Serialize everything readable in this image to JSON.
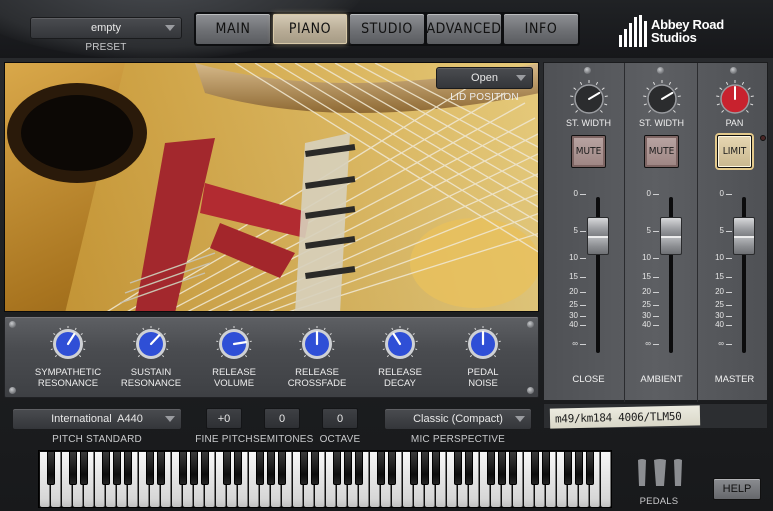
{
  "header": {
    "preset": {
      "value": "empty",
      "label": "PRESET"
    },
    "tabs": [
      {
        "label": "MAIN",
        "active": false
      },
      {
        "label": "PIANO",
        "active": true
      },
      {
        "label": "STUDIO",
        "active": false
      },
      {
        "label": "ADVANCED",
        "active": false
      },
      {
        "label": "INFO",
        "active": false
      }
    ],
    "logo": {
      "line1": "Abbey Road",
      "line2": "Studios"
    }
  },
  "piano_view": {
    "lid_position": {
      "value": "Open",
      "label": "LID POSITION"
    }
  },
  "knobs": [
    {
      "line1": "SYMPATHETIC",
      "line2": "RESONANCE",
      "level": 0.62
    },
    {
      "line1": "SUSTAIN",
      "line2": "RESONANCE",
      "level": 0.66
    },
    {
      "line1": "RELEASE",
      "line2": "VOLUME",
      "level": 0.8
    },
    {
      "line1": "RELEASE",
      "line2": "CROSSFADE",
      "level": 0.5
    },
    {
      "line1": "RELEASE",
      "line2": "DECAY",
      "level": 0.38
    },
    {
      "line1": "PEDAL",
      "line2": "NOISE",
      "level": 0.5
    }
  ],
  "bottom": {
    "pitch_standard": {
      "value": "International  A440",
      "label": "PITCH STANDARD"
    },
    "fine_pitch": {
      "value": "+0",
      "label": "FINE PITCH"
    },
    "semitones": {
      "value": "0",
      "label": "SEMITONES"
    },
    "octave": {
      "value": "0",
      "label": "OCTAVE"
    },
    "mic_perspective": {
      "value": "Classic (Compact)",
      "label": "MIC PERSPECTIVE"
    }
  },
  "mixer": {
    "scale": [
      "0",
      "5",
      "10",
      "15",
      "20",
      "25",
      "30",
      "40",
      "∞"
    ],
    "channels": [
      {
        "name": "CLOSE",
        "knob_label": "ST. WIDTH",
        "button": "MUTE",
        "knob_level": 0.72
      },
      {
        "name": "AMBIENT",
        "knob_label": "ST. WIDTH",
        "button": "MUTE",
        "knob_level": 0.72
      },
      {
        "name": "MASTER",
        "knob_label": "PAN",
        "button": "LIMIT",
        "knob_level": 0.5
      }
    ],
    "mic_note": "m49/km184 4006/TLM50"
  },
  "footer": {
    "pedals_label": "PEDALS",
    "help_label": "HELP"
  },
  "colors": {
    "knob_blue": "#2f4fd6",
    "pan_red": "#c8222e",
    "active_tab": "#c9bea7"
  }
}
